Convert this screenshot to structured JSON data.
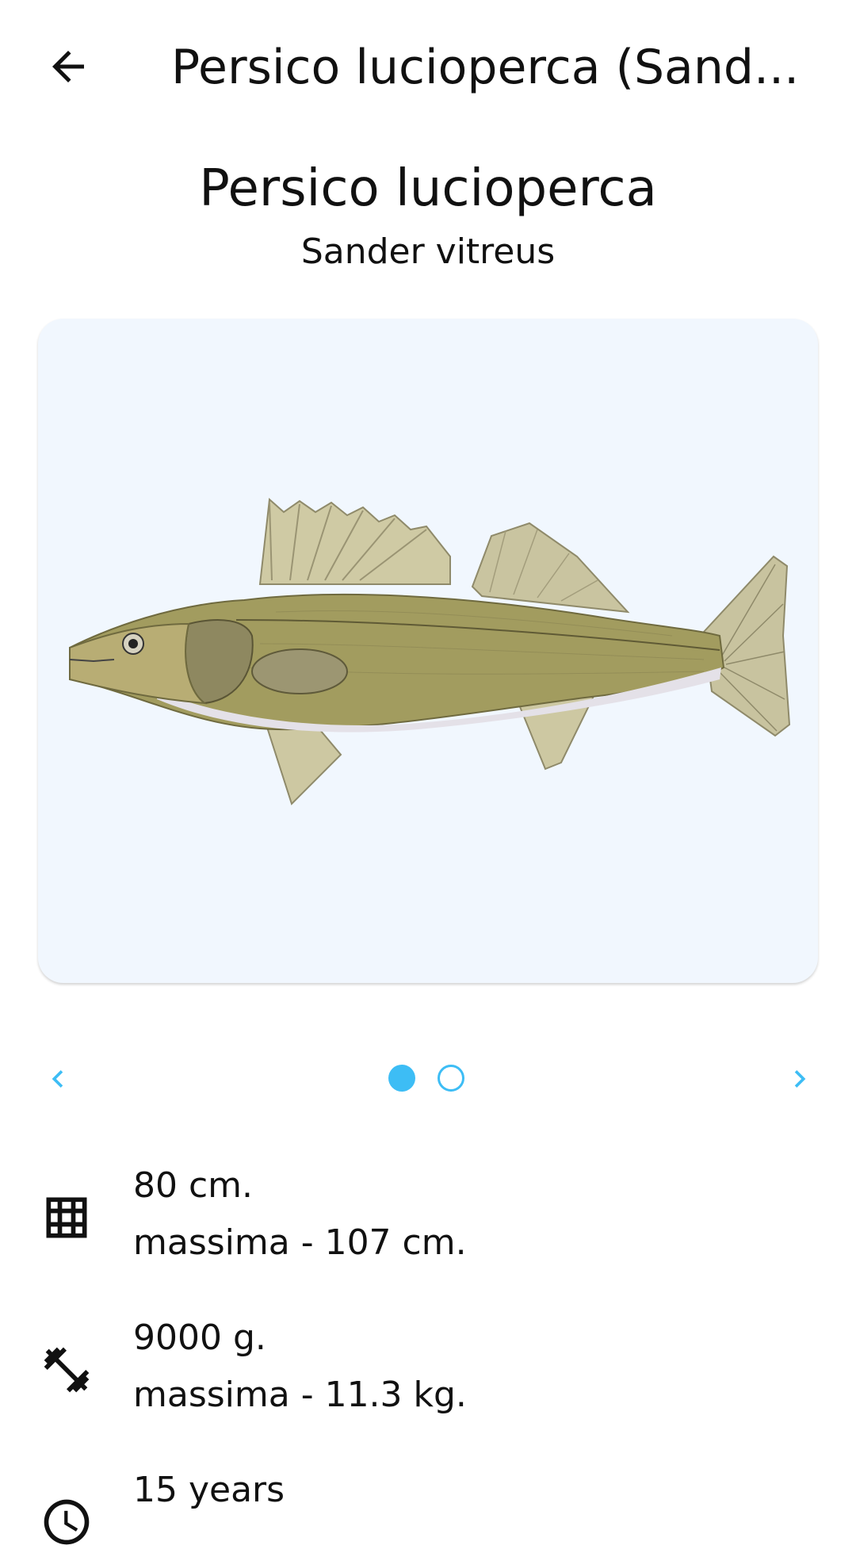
{
  "appbar": {
    "title": "Persico lucioperca (Sand...",
    "back_icon": "arrow-left-icon"
  },
  "species": {
    "common_name": "Persico lucioperca",
    "latin_name": "Sander vitreus"
  },
  "carousel": {
    "image_description": "fish-illustration",
    "prev_icon": "chevron-left-icon",
    "next_icon": "chevron-right-icon",
    "page_count": 2,
    "current_page": 1,
    "accent_color": "#3dbdf5"
  },
  "info": {
    "length": {
      "icon": "grid-icon",
      "value": "80 cm.",
      "max": "massima - 107 cm."
    },
    "weight": {
      "icon": "dumbbell-icon",
      "value": "9000 g.",
      "max": "massima - 11.3 kg."
    },
    "age": {
      "icon": "clock-icon",
      "value": "15 years"
    }
  }
}
